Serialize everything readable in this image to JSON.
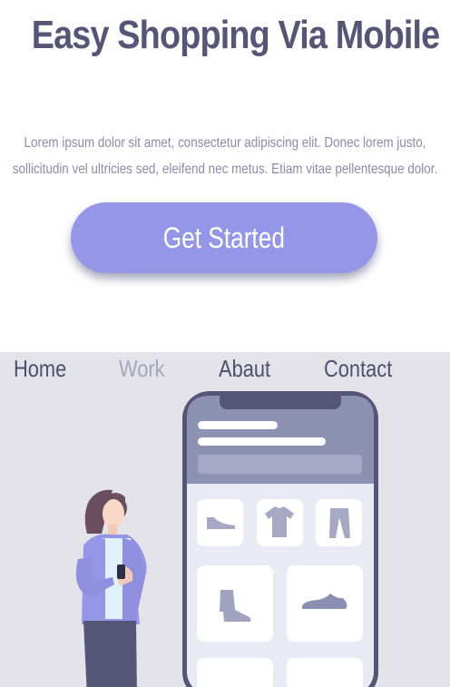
{
  "hero": {
    "title": "Easy Shopping Via Mobile",
    "description": "Lorem ipsum dolor sit amet, consectetur adipiscing elit. Donec lorem justo, sollicitudin vel ultricies sed, eleifend nec metus. Etiam vitae pellentesque dolor.",
    "cta_label": "Get Started"
  },
  "nav": {
    "items": [
      {
        "label": "Home",
        "active": false
      },
      {
        "label": "Work",
        "active": true
      },
      {
        "label": "Abaut",
        "active": false
      },
      {
        "label": "Contact",
        "active": false
      }
    ]
  },
  "colors": {
    "title": "#555677",
    "accent": "#9496e7",
    "panel_bg": "#e4e3ea",
    "phone_frame": "#555677",
    "nav_text": "#4e4f6e",
    "nav_muted": "#a6a6bd"
  },
  "illustration": {
    "icons": [
      "shoe-icon",
      "tshirt-icon",
      "pants-icon",
      "boot-icon",
      "sneaker-icon"
    ]
  }
}
